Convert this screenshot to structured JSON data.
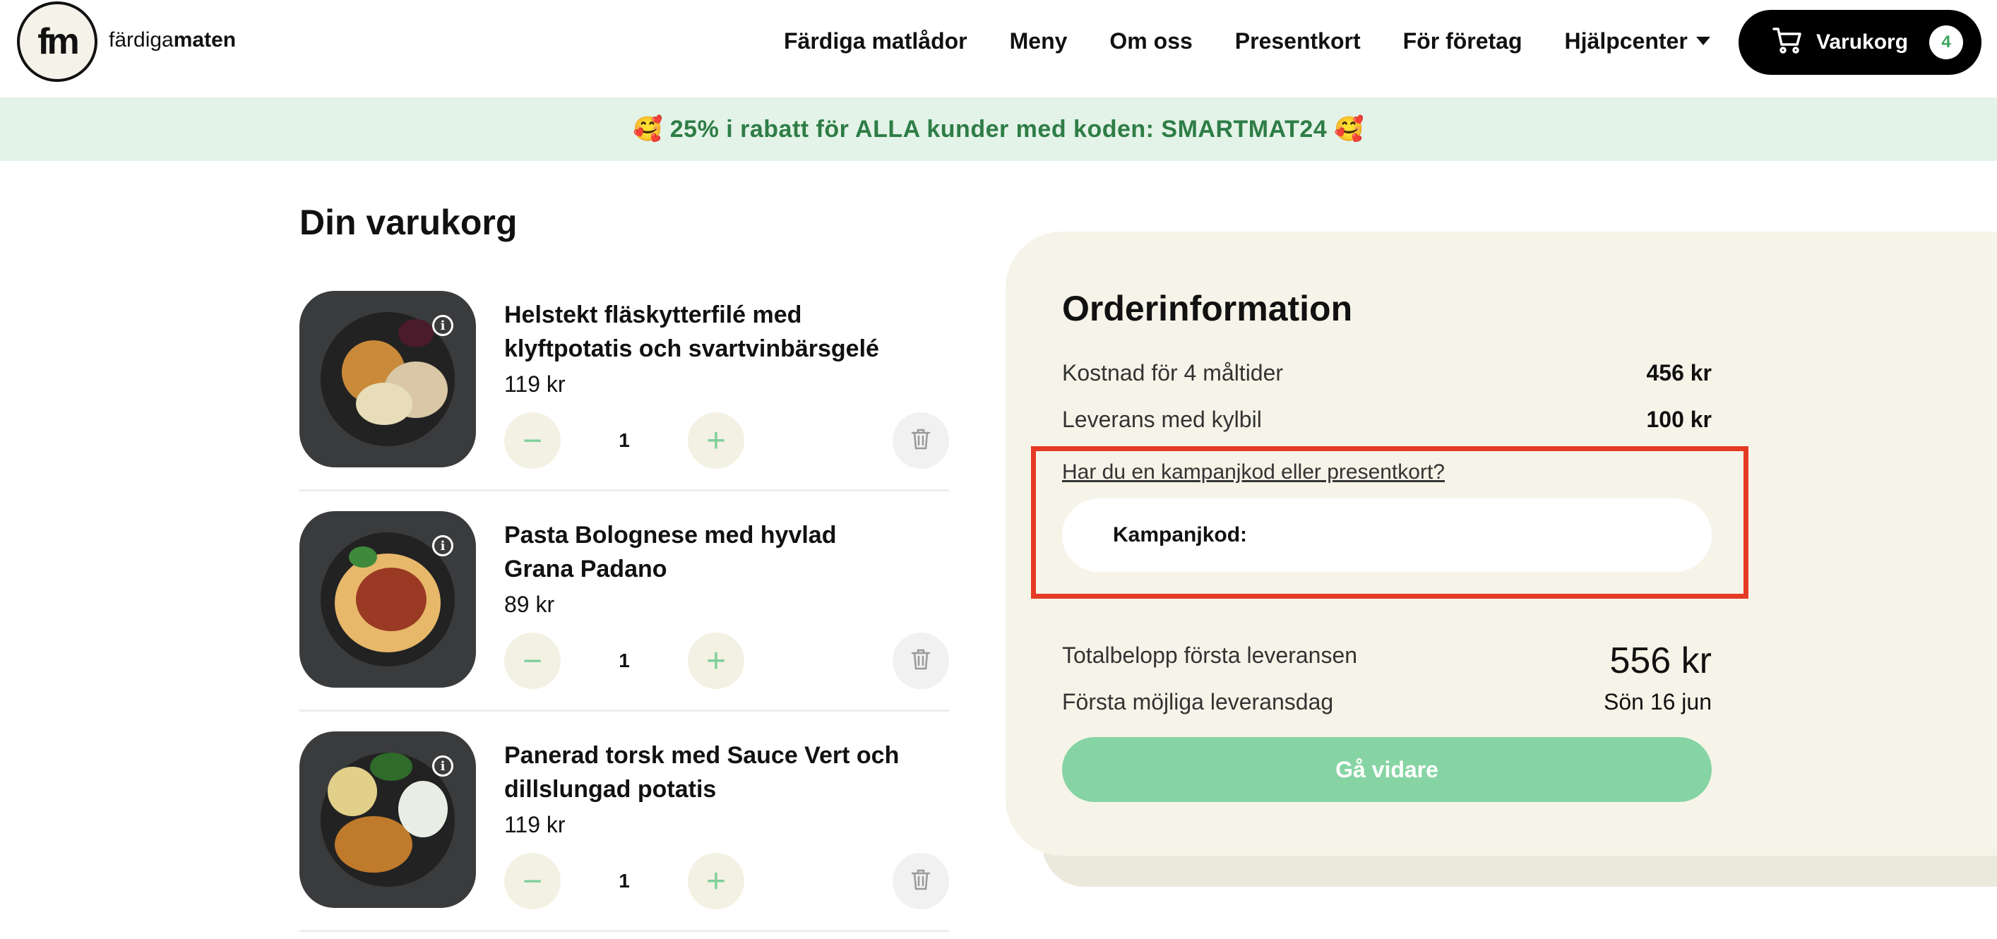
{
  "header": {
    "logo_mark": "fm",
    "logo_word_light": "färdiga",
    "logo_word_bold": "maten",
    "nav": [
      "Färdiga matlådor",
      "Meny",
      "Om oss",
      "Presentkort",
      "För företag",
      "Hjälpcenter"
    ],
    "cart_label": "Varukorg",
    "cart_count": "4"
  },
  "banner": {
    "text": "🥰 25% i rabatt för ALLA kunder med koden: SMARTMAT24 🥰"
  },
  "cart": {
    "title": "Din varukorg",
    "items": [
      {
        "name": "Helstekt fläskytterfilé med klyftpotatis och svartvinbärsgelé",
        "price": "119 kr",
        "qty": "1"
      },
      {
        "name": "Pasta Bolognese med hyvlad Grana Padano",
        "price": "89 kr",
        "qty": "1"
      },
      {
        "name": "Panerad torsk med Sauce Vert och dillslungad potatis",
        "price": "119 kr",
        "qty": "1"
      }
    ],
    "minus": "−",
    "plus": "+",
    "info": "i"
  },
  "order": {
    "title": "Orderinformation",
    "cost_label": "Kostnad för 4 måltider",
    "cost_value": "456 kr",
    "delivery_label": "Leverans med kylbil",
    "delivery_value": "100 kr",
    "campaign_link": "Har du en kampanjkod eller presentkort?",
    "campaign_input_label": "Kampanjkod:",
    "campaign_input_value": "",
    "total_label": "Totalbelopp första leveransen",
    "total_value": "556 kr",
    "first_day_label": "Första möjliga leveransdag",
    "first_day_value": "Sön 16 jun",
    "continue_label": "Gå vidare"
  },
  "colors": {
    "accent_green": "#86d4a3",
    "banner_bg": "#e3f3e7",
    "panel_bg": "#f6f4e8",
    "highlight_red": "#e53a24"
  },
  "icons": [
    "cart-icon",
    "chevron-down-icon",
    "info-icon",
    "minus-icon",
    "plus-icon",
    "trash-icon"
  ]
}
